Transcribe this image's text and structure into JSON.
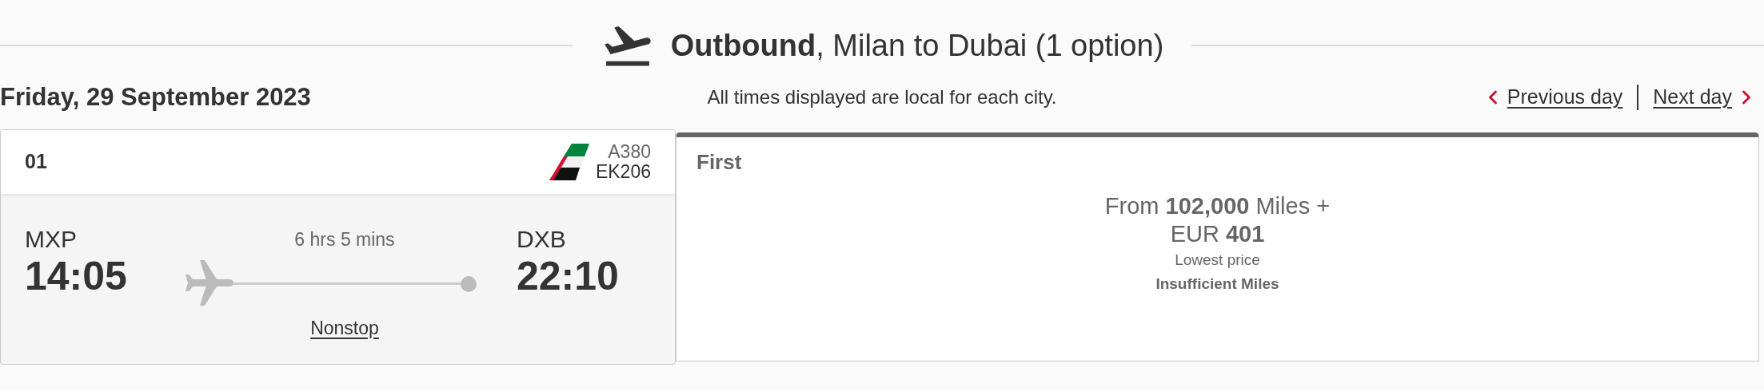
{
  "title": "**Outbound**, Milan to Dubai (1 option)",
  "date": "Friday, 29 September 2023",
  "notice": "All times displayed are local for each city.",
  "nav": [
    {
      "label": "Previous day",
      "kind": "previous"
    },
    {
      "label": "Next day",
      "kind": "next"
    }
  ],
  "flights": [
    {
      "number": "01",
      "aircraft": "A380",
      "flight": "EK206",
      "origin": {
        "code": "MXP",
        "time": "14:05"
      },
      "destination": {
        "code": "DXB",
        "time": "22:10"
      },
      "duration": "6 hrs 5 mins",
      "stops": "Nonstop"
    }
  ],
  "fares": [
    {
      "cabin": "First",
      "price_line_1": "From **102,000** Miles +",
      "price_line_2": "EUR **401**",
      "note": "Lowest price",
      "status": "Insufficient Miles"
    }
  ]
}
